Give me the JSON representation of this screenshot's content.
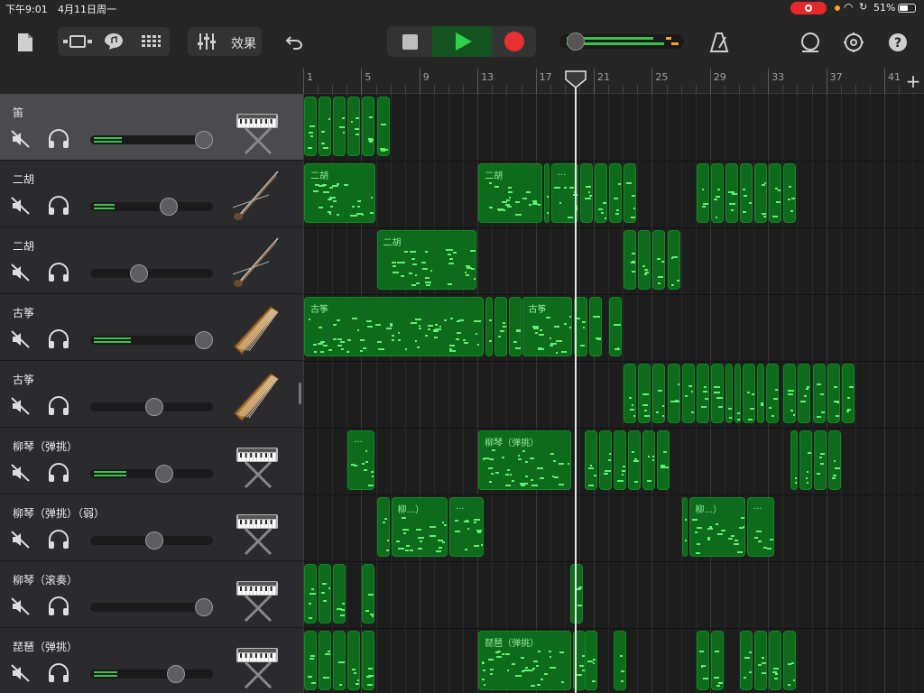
{
  "status_bar": {
    "time": "下午9:01",
    "date": "4月11日周一",
    "battery_pct": "51%",
    "icons": [
      "screen-record-icon",
      "wifi-icon",
      "rotation-lock-icon",
      "battery-icon"
    ]
  },
  "toolbar": {
    "effects_label": "效果",
    "icons": [
      "my-songs-icon",
      "view-toggle-icon",
      "browser-icon",
      "grid-icon",
      "mixer-icon",
      "undo-icon",
      "stop-icon",
      "play-icon",
      "record-icon",
      "metronome-icon",
      "loop-icon",
      "settings-icon",
      "help-icon"
    ],
    "colors": {
      "play": "#2fd14b",
      "record": "#e83030",
      "region": "#0f6b1c",
      "note": "#5ff070"
    }
  },
  "ruler": {
    "bars": [
      "1",
      "5",
      "9",
      "13",
      "17",
      "21",
      "25",
      "29",
      "33",
      "37",
      "41"
    ],
    "add_label": "+"
  },
  "tracks": [
    {
      "name": "笛",
      "selected": true,
      "volume": 0.93,
      "level": 0.24,
      "instrument": "keyboard"
    },
    {
      "name": "二胡",
      "selected": false,
      "volume": 0.64,
      "level": 0.18,
      "instrument": "erhu"
    },
    {
      "name": "二胡",
      "selected": false,
      "volume": 0.4,
      "level": 0.0,
      "instrument": "erhu"
    },
    {
      "name": "古筝",
      "selected": false,
      "volume": 0.93,
      "level": 0.32,
      "instrument": "guzheng"
    },
    {
      "name": "古筝",
      "selected": false,
      "volume": 0.52,
      "level": 0.0,
      "instrument": "guzheng"
    },
    {
      "name": "柳琴（弹挑）",
      "selected": false,
      "volume": 0.6,
      "level": 0.28,
      "instrument": "keyboard"
    },
    {
      "name": "柳琴（弹挑）（弱）",
      "selected": false,
      "volume": 0.52,
      "level": 0.0,
      "instrument": "keyboard"
    },
    {
      "name": "柳琴（滚奏）",
      "selected": false,
      "volume": 0.93,
      "level": 0.0,
      "instrument": "keyboard"
    },
    {
      "name": "琵琶（弹挑）",
      "selected": false,
      "volume": 0.7,
      "level": 0.2,
      "instrument": "keyboard"
    }
  ],
  "region_labels": {
    "erhu": "二胡",
    "guzheng": "古筝",
    "liuqin": "柳琴（弹挑）",
    "liuqin_short": "柳...）",
    "liuqin_short2": "柳...）",
    "pipa": "琵琶（弹挑）",
    "ellipsis": "..."
  }
}
